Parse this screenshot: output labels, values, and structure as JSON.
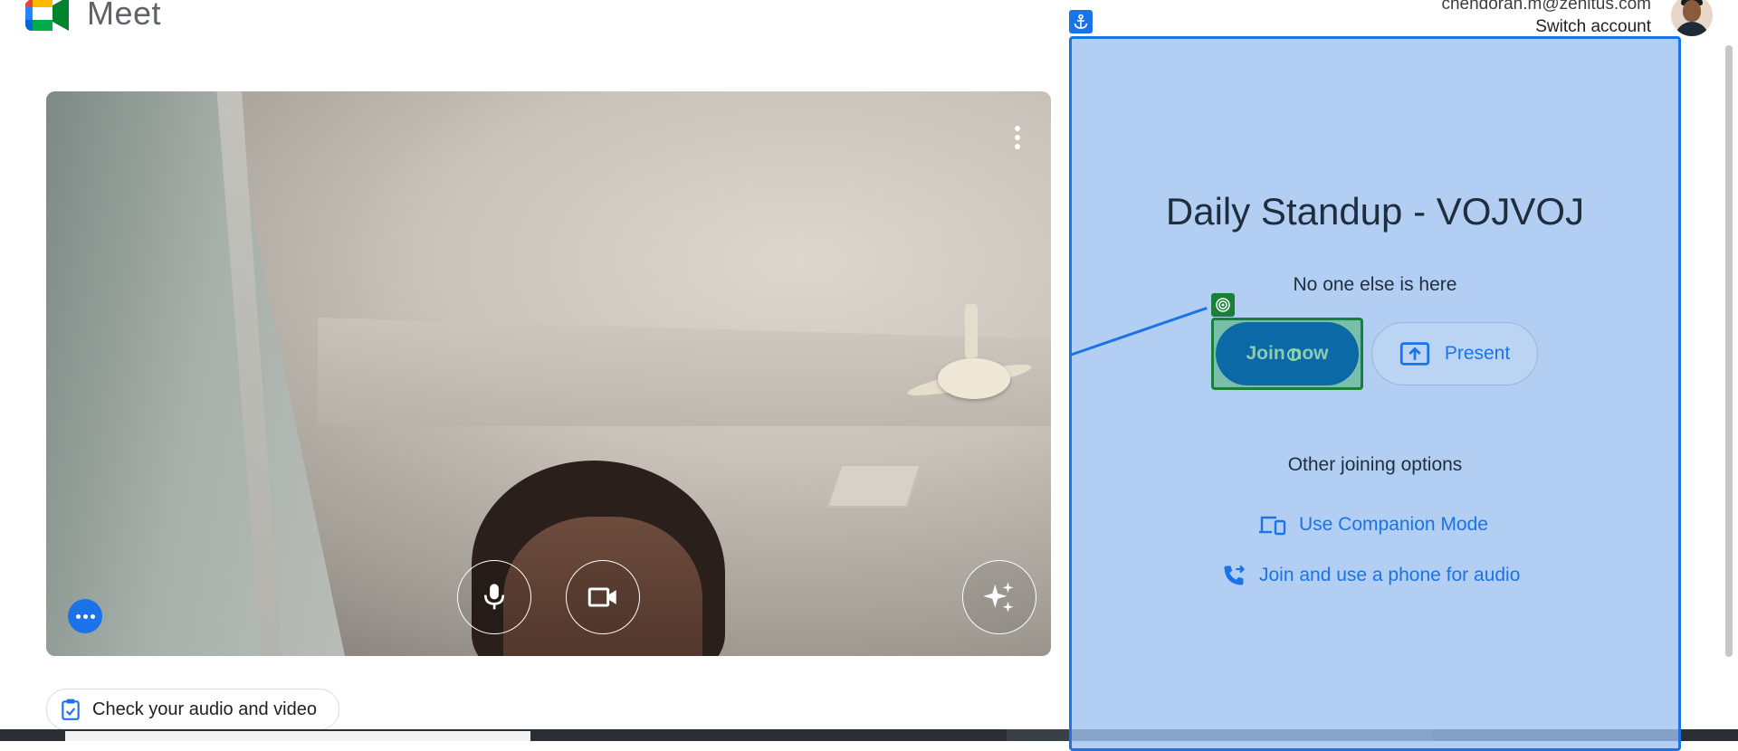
{
  "app": {
    "name": "Meet"
  },
  "account": {
    "email": "chendoran.m@zenitus.com",
    "switch_label": "Switch account"
  },
  "preview": {
    "more_options_icon": "more-vert-icon",
    "mic_icon": "mic-icon",
    "camera_icon": "videocam-icon",
    "effects_icon": "sparkle-icon",
    "side_menu_icon": "more-horiz-icon"
  },
  "check_audio": {
    "label": "Check your audio and video",
    "icon": "clipboard-check-icon"
  },
  "meeting": {
    "title": "Daily Standup - VOJVOJ",
    "status": "No one else is here",
    "join_label": "Join now",
    "present_label": "Present",
    "other_options_label": "Other joining options",
    "companion_label": "Use Companion Mode",
    "phone_label": "Join and use a phone for audio"
  },
  "colors": {
    "accent": "#1a73e8",
    "overlay": "#9cc2f0",
    "join_highlight": "#188038"
  }
}
